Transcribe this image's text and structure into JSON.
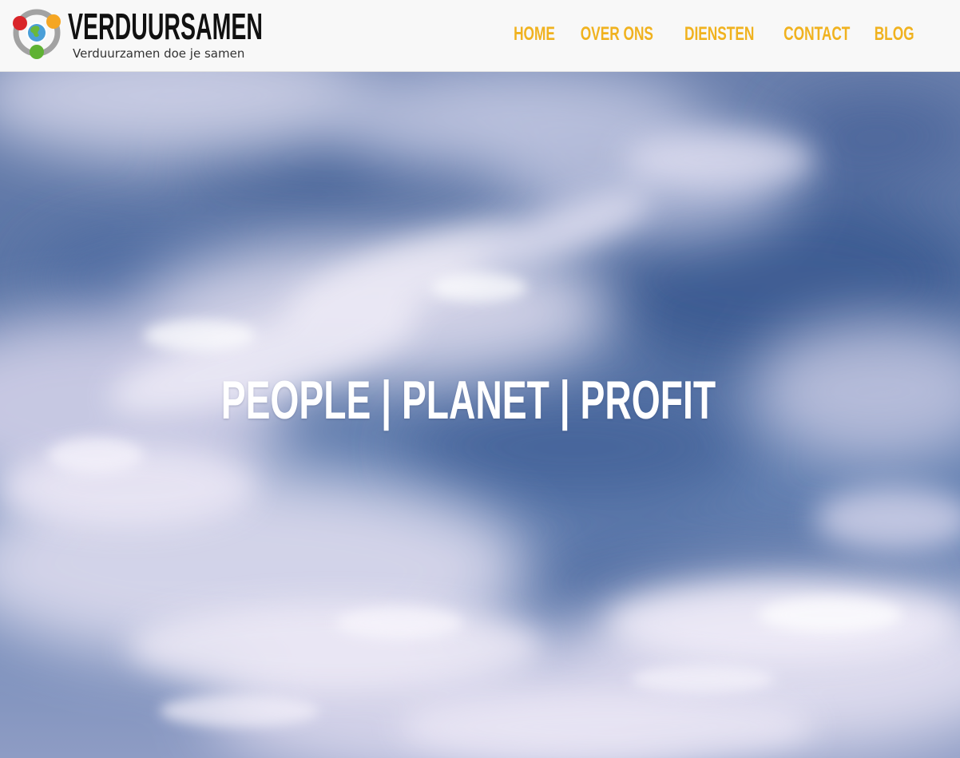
{
  "brand": {
    "title": "VERDUURSAMEN",
    "tagline": "Verduurzamen doe je samen",
    "logo_icon": "globe-connected-dots-icon",
    "logo_colors": [
      "#d9252a",
      "#f5a623",
      "#5fb233",
      "#9b9b9b"
    ]
  },
  "nav": {
    "items": [
      {
        "label": "HOME"
      },
      {
        "label": "OVER ONS"
      },
      {
        "label": "DIENSTEN"
      },
      {
        "label": "CONTACT"
      },
      {
        "label": "BLOG"
      }
    ],
    "color": "#f0b21f"
  },
  "hero": {
    "headline": "PEOPLE | PLANET | PROFIT",
    "background": "cloudy-sky-image"
  }
}
